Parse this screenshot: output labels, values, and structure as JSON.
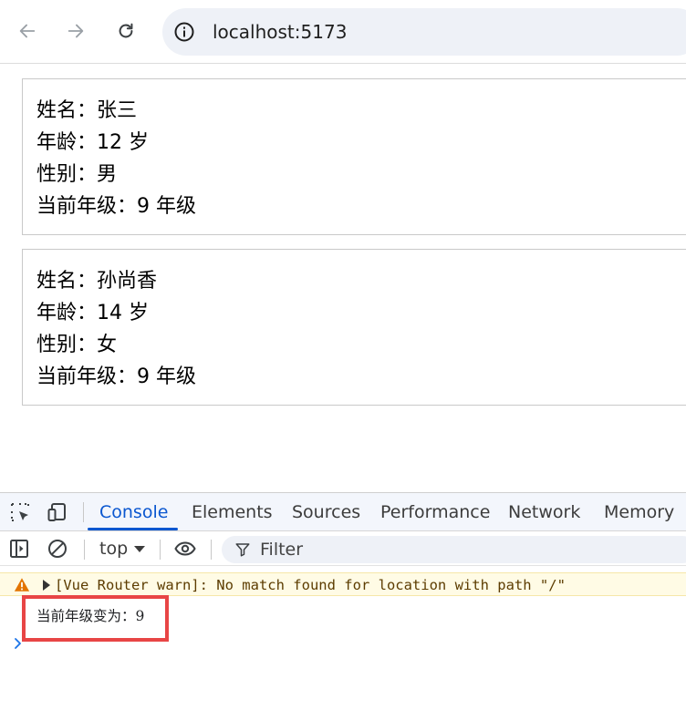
{
  "browser": {
    "url": "localhost:5173",
    "icons": {
      "back": "back-arrow-icon",
      "forward": "forward-arrow-icon",
      "reload": "reload-icon",
      "site_info": "info-circle-icon"
    }
  },
  "students": [
    {
      "name_line": "姓名：张三",
      "age_line": "年龄：12 岁",
      "gender_line": "性别：男",
      "grade_line": "当前年级：9 年级"
    },
    {
      "name_line": "姓名：孙尚香",
      "age_line": "年龄：14 岁",
      "gender_line": "性别：女",
      "grade_line": "当前年级：9 年级"
    }
  ],
  "devtools": {
    "tabs": [
      {
        "label": "Console",
        "active": true
      },
      {
        "label": "Elements",
        "active": false
      },
      {
        "label": "Sources",
        "active": false
      },
      {
        "label": "Performance",
        "active": false
      },
      {
        "label": "Network",
        "active": false
      },
      {
        "label": "Memory",
        "active": false
      }
    ],
    "context_selector": "top",
    "filter_placeholder": "Filter",
    "console": {
      "warning": "[Vue Router warn]: No match found for location with path \"/\"",
      "log": "当前年级变为：9"
    },
    "colors": {
      "accent": "#0b57d0",
      "warning_bg": "#fffbe5",
      "highlight": "#e84545"
    }
  }
}
